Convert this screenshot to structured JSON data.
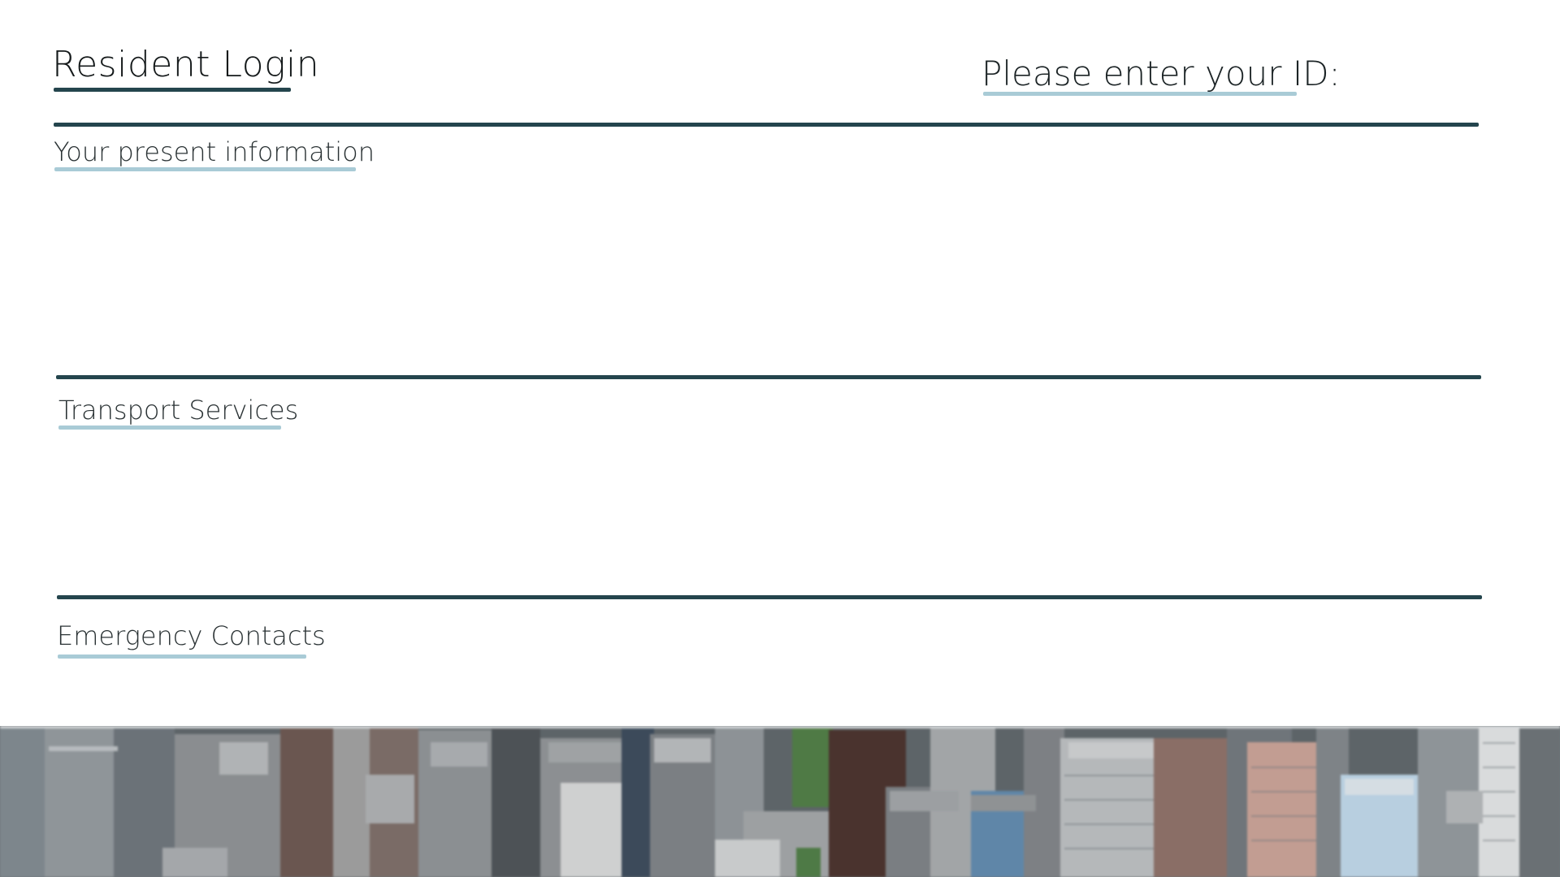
{
  "header": {
    "title": "Resident Login",
    "id_prompt": "Please enter your ID:"
  },
  "sections": [
    {
      "label": "Your present information"
    },
    {
      "label": "Transport Services"
    },
    {
      "label": "Emergency Contacts"
    }
  ],
  "colors": {
    "accent_dark": "#24454d",
    "accent_light": "#a9cbd6",
    "text": "#1c2426",
    "background": "#ffffff"
  },
  "banner": {
    "image": "city-skyline-aerial-photo"
  }
}
